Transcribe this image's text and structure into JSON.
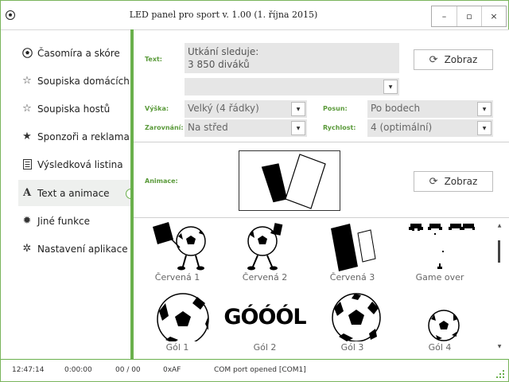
{
  "window": {
    "title": "LED panel pro sport v. 1.00 (1. října 2015)",
    "minimize": "–",
    "maximize": "▫",
    "close": "×"
  },
  "sidebar": {
    "items": [
      {
        "label": "Časomíra a skóre",
        "icon": "soccer-ball-icon"
      },
      {
        "label": "Soupiska domácích",
        "icon": "star-outline-icon"
      },
      {
        "label": "Soupiska hostů",
        "icon": "star-outline-icon"
      },
      {
        "label": "Sponzoři a reklama",
        "icon": "star-filled-icon"
      },
      {
        "label": "Výsledková listina",
        "icon": "document-icon"
      },
      {
        "label": "Text a animace",
        "icon": "text-icon",
        "active": true
      },
      {
        "label": "Jiné funkce",
        "icon": "sun-icon"
      },
      {
        "label": "Nastavení aplikace",
        "icon": "gear-icon"
      }
    ]
  },
  "text_panel": {
    "text_label": "Text:",
    "text_value": "Utkání sleduje:\n3 850 diváků",
    "extra_combo": "",
    "show_button": "Zobraz",
    "height_label": "Výška:",
    "height_value": "Velký (4 řádky)",
    "align_label": "Zarovnání:",
    "align_value": "Na střed",
    "scroll_label": "Posun:",
    "scroll_value": "Po bodech",
    "speed_label": "Rychlost:",
    "speed_value": "4 (optimální)"
  },
  "animation_panel": {
    "label": "Animace:",
    "show_button": "Zobraz"
  },
  "gallery": {
    "items": [
      {
        "label": "Červená 1"
      },
      {
        "label": "Červená 2"
      },
      {
        "label": "Červená 3"
      },
      {
        "label": "Game over"
      },
      {
        "label": "Gól 1"
      },
      {
        "label": "Gól 2",
        "image_text": "GÓÓÓL"
      },
      {
        "label": "Gól 3"
      },
      {
        "label": "Gól 4"
      }
    ]
  },
  "status": {
    "time": "12:47:14",
    "timer": "0:00:00",
    "count": "00 / 00",
    "address": "0xAF",
    "port": "COM port opened [COM1]"
  },
  "colors": {
    "accent": "#6ab04c",
    "label": "#5a9a3a",
    "field": "#e6e6e6"
  }
}
